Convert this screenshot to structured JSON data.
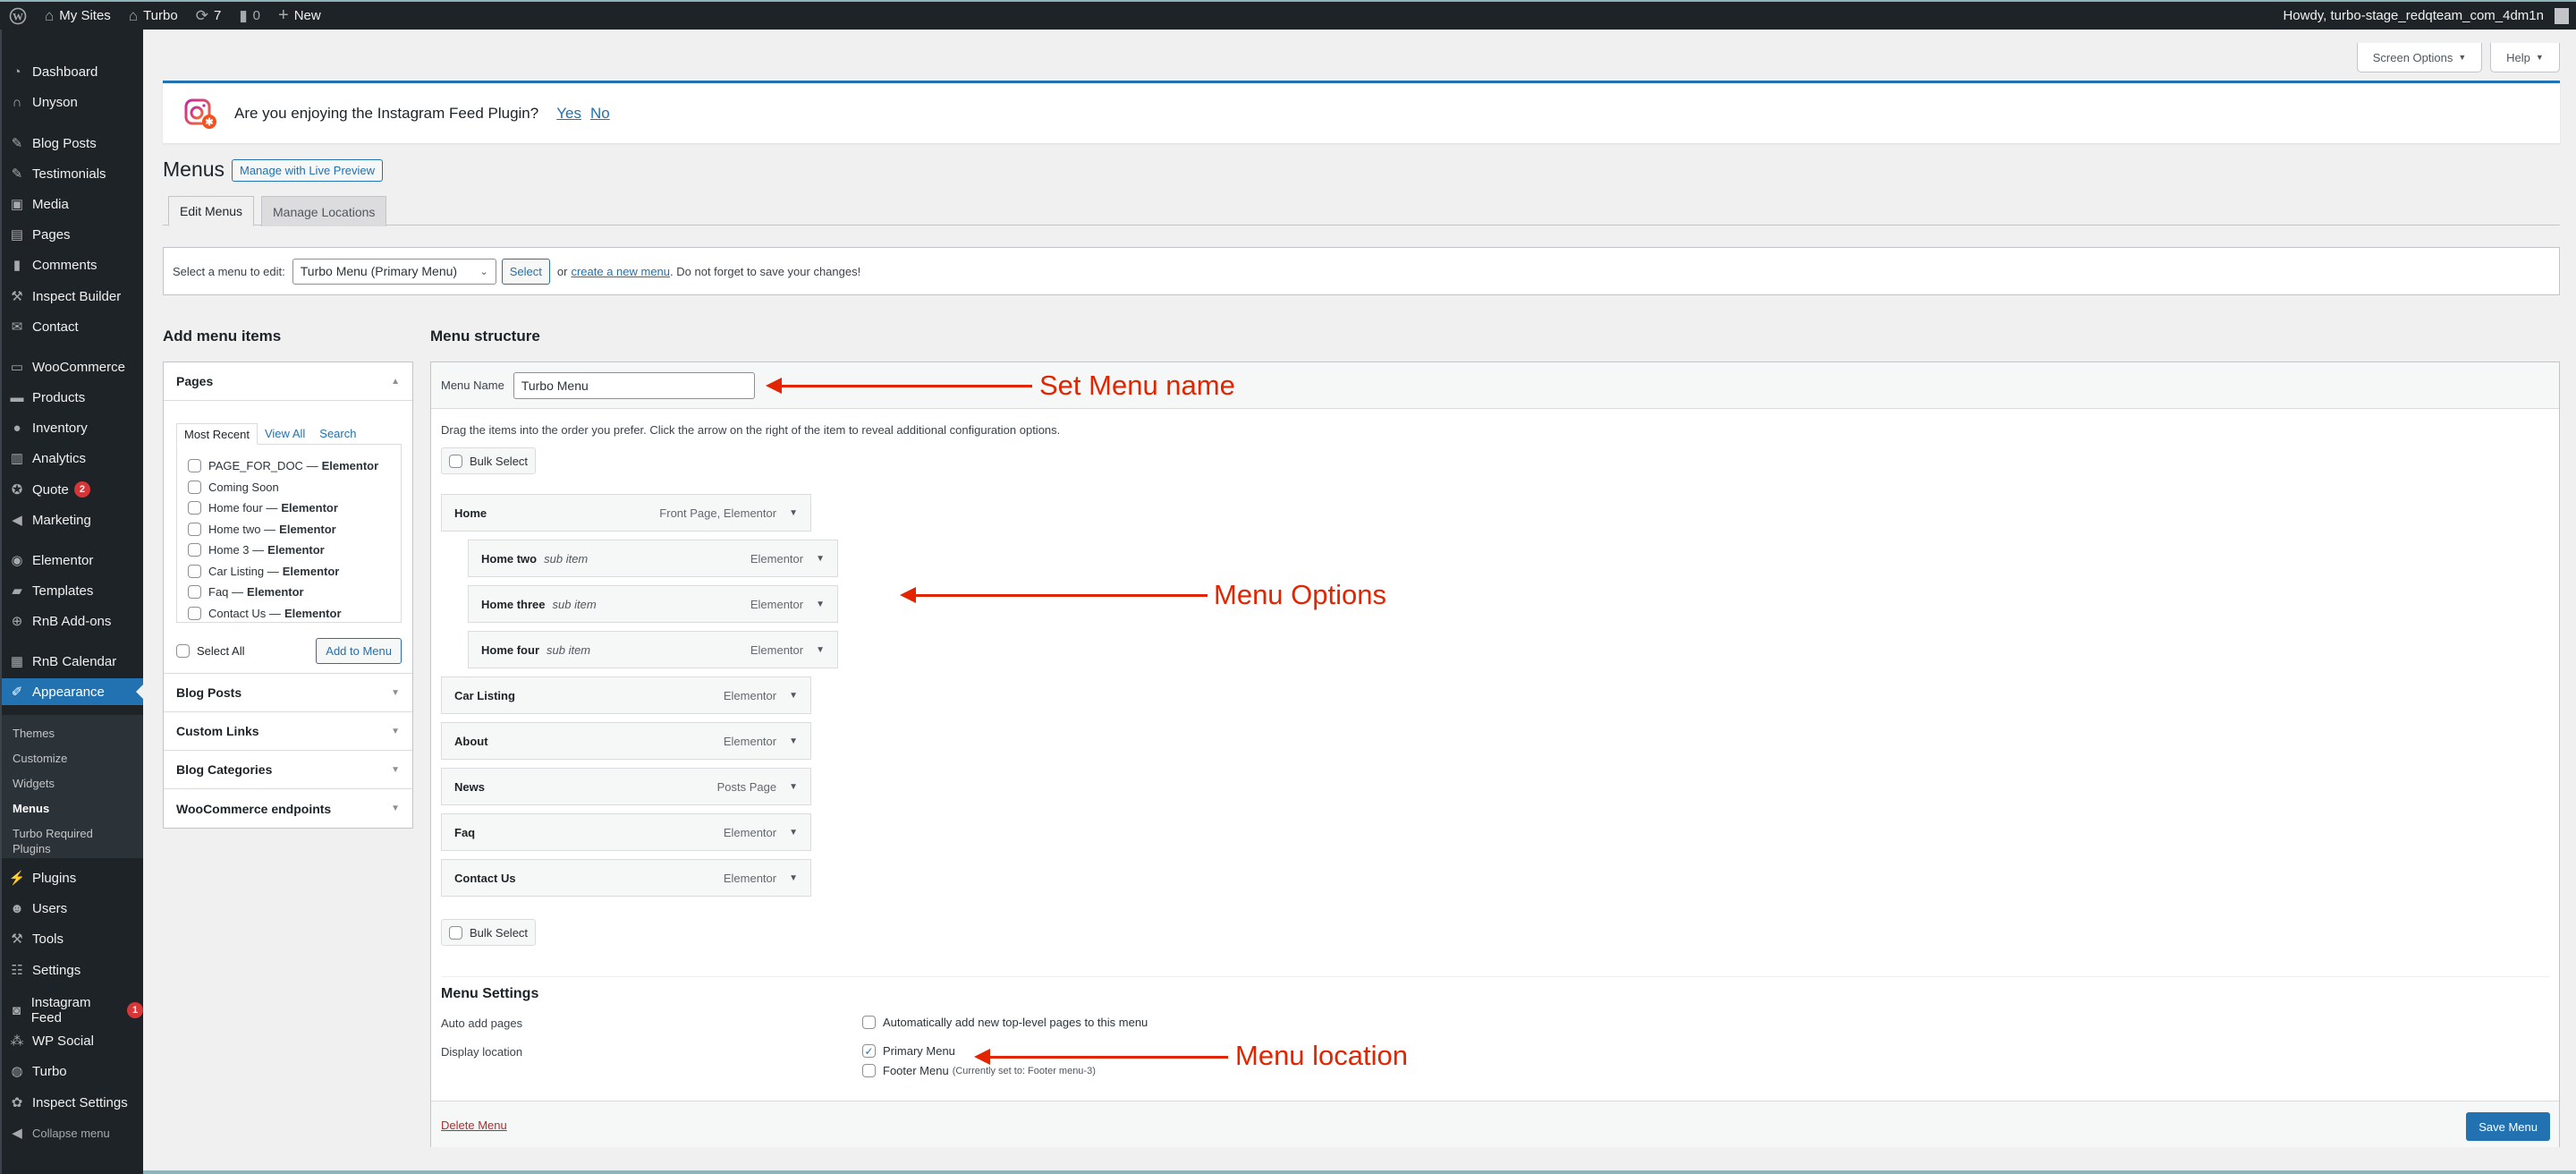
{
  "adminbar": {
    "my_sites": "My Sites",
    "site_name": "Turbo",
    "updates_count": "7",
    "comments_count": "0",
    "new_label": "New",
    "howdy": "Howdy, turbo-stage_redqteam_com_4dm1n"
  },
  "sidebar": {
    "items": [
      {
        "label": "Dashboard",
        "icon": "dashboard-icon"
      },
      {
        "label": "Unyson",
        "icon": "unyson-icon"
      },
      {
        "label": "Blog Posts",
        "icon": "pin-icon"
      },
      {
        "label": "Testimonials",
        "icon": "pin-icon"
      },
      {
        "label": "Media",
        "icon": "media-icon"
      },
      {
        "label": "Pages",
        "icon": "pages-icon"
      },
      {
        "label": "Comments",
        "icon": "comment-icon"
      },
      {
        "label": "Inspect Builder",
        "icon": "wrench-icon"
      },
      {
        "label": "Contact",
        "icon": "mail-icon"
      },
      {
        "label": "WooCommerce",
        "icon": "woo-icon"
      },
      {
        "label": "Products",
        "icon": "archive-icon"
      },
      {
        "label": "Inventory",
        "icon": "inventory-icon"
      },
      {
        "label": "Analytics",
        "icon": "chart-icon"
      },
      {
        "label": "Quote",
        "icon": "award-icon",
        "badge": "2"
      },
      {
        "label": "Marketing",
        "icon": "megaphone-icon"
      },
      {
        "label": "Elementor",
        "icon": "elementor-icon"
      },
      {
        "label": "Templates",
        "icon": "folder-icon"
      },
      {
        "label": "RnB Add-ons",
        "icon": "plus-circle-icon"
      },
      {
        "label": "RnB Calendar",
        "icon": "calendar-icon"
      },
      {
        "label": "Appearance",
        "icon": "brush-icon"
      },
      {
        "label": "Plugins",
        "icon": "plug-icon"
      },
      {
        "label": "Users",
        "icon": "user-icon"
      },
      {
        "label": "Tools",
        "icon": "wrench-icon"
      },
      {
        "label": "Settings",
        "icon": "settings-icon"
      },
      {
        "label": "Instagram Feed",
        "icon": "camera-icon",
        "badge": "1"
      },
      {
        "label": "WP Social",
        "icon": "social-icon"
      },
      {
        "label": "Turbo",
        "icon": "globe-icon"
      },
      {
        "label": "Inspect Settings",
        "icon": "palm-icon"
      },
      {
        "label": "Collapse menu",
        "icon": "collapse-icon"
      }
    ],
    "appearance_sub": [
      "Themes",
      "Customize",
      "Widgets",
      "Menus",
      "Turbo Required Plugins"
    ]
  },
  "screen_options": "Screen Options",
  "help": "Help",
  "notice": {
    "text": "Are you enjoying the Instagram Feed Plugin?",
    "yes": "Yes",
    "no": "No"
  },
  "page": {
    "title": "Menus",
    "live_preview": "Manage with Live Preview",
    "tabs": [
      "Edit Menus",
      "Manage Locations"
    ]
  },
  "manage": {
    "label": "Select a menu to edit:",
    "selected": "Turbo Menu (Primary Menu)",
    "select_btn": "Select",
    "or": "or",
    "create_link": "create a new menu",
    "suffix": ". Do not forget to save your changes!"
  },
  "add_items": {
    "heading": "Add menu items",
    "pages_title": "Pages",
    "inner_tabs": [
      "Most Recent",
      "View All",
      "Search"
    ],
    "pages": [
      {
        "name": "PAGE_FOR_DOC",
        "suffix": "Elementor"
      },
      {
        "name": "Coming Soon",
        "suffix": ""
      },
      {
        "name": "Home four",
        "suffix": "Elementor"
      },
      {
        "name": "Home two",
        "suffix": "Elementor"
      },
      {
        "name": "Home 3",
        "suffix": "Elementor"
      },
      {
        "name": "Car Listing",
        "suffix": "Elementor"
      },
      {
        "name": "Faq",
        "suffix": "Elementor"
      },
      {
        "name": "Contact Us",
        "suffix": "Elementor"
      }
    ],
    "select_all": "Select All",
    "add_to_menu": "Add to Menu",
    "other_sections": [
      "Blog Posts",
      "Custom Links",
      "Blog Categories",
      "WooCommerce endpoints"
    ]
  },
  "structure": {
    "heading": "Menu structure",
    "menu_name_label": "Menu Name",
    "menu_name_value": "Turbo Menu",
    "drag_hint": "Drag the items into the order you prefer. Click the arrow on the right of the item to reveal additional configuration options.",
    "bulk_select": "Bulk Select",
    "items": [
      {
        "title": "Home",
        "sub": "",
        "type": "Front Page, Elementor",
        "depth": 0
      },
      {
        "title": "Home two",
        "sub": "sub item",
        "type": "Elementor",
        "depth": 1
      },
      {
        "title": "Home three",
        "sub": "sub item",
        "type": "Elementor",
        "depth": 1
      },
      {
        "title": "Home four",
        "sub": "sub item",
        "type": "Elementor",
        "depth": 1
      },
      {
        "title": "Car Listing",
        "sub": "",
        "type": "Elementor",
        "depth": 0
      },
      {
        "title": "About",
        "sub": "",
        "type": "Elementor",
        "depth": 0
      },
      {
        "title": "News",
        "sub": "",
        "type": "Posts Page",
        "depth": 0
      },
      {
        "title": "Faq",
        "sub": "",
        "type": "Elementor",
        "depth": 0
      },
      {
        "title": "Contact Us",
        "sub": "",
        "type": "Elementor",
        "depth": 0
      }
    ]
  },
  "settings": {
    "heading": "Menu Settings",
    "auto_add_label": "Auto add pages",
    "auto_add_option": "Automatically add new top-level pages to this menu",
    "auto_add_checked": false,
    "display_label": "Display location",
    "locations": [
      {
        "name": "Primary Menu",
        "note": "",
        "checked": true
      },
      {
        "name": "Footer Menu",
        "note": "(Currently set to: Footer menu-3)",
        "checked": false
      }
    ],
    "delete": "Delete Menu",
    "save": "Save Menu"
  },
  "annotations": {
    "menu_name": "Set Menu name",
    "options": "Menu Options",
    "location": "Menu location",
    "color": "#e32400"
  }
}
